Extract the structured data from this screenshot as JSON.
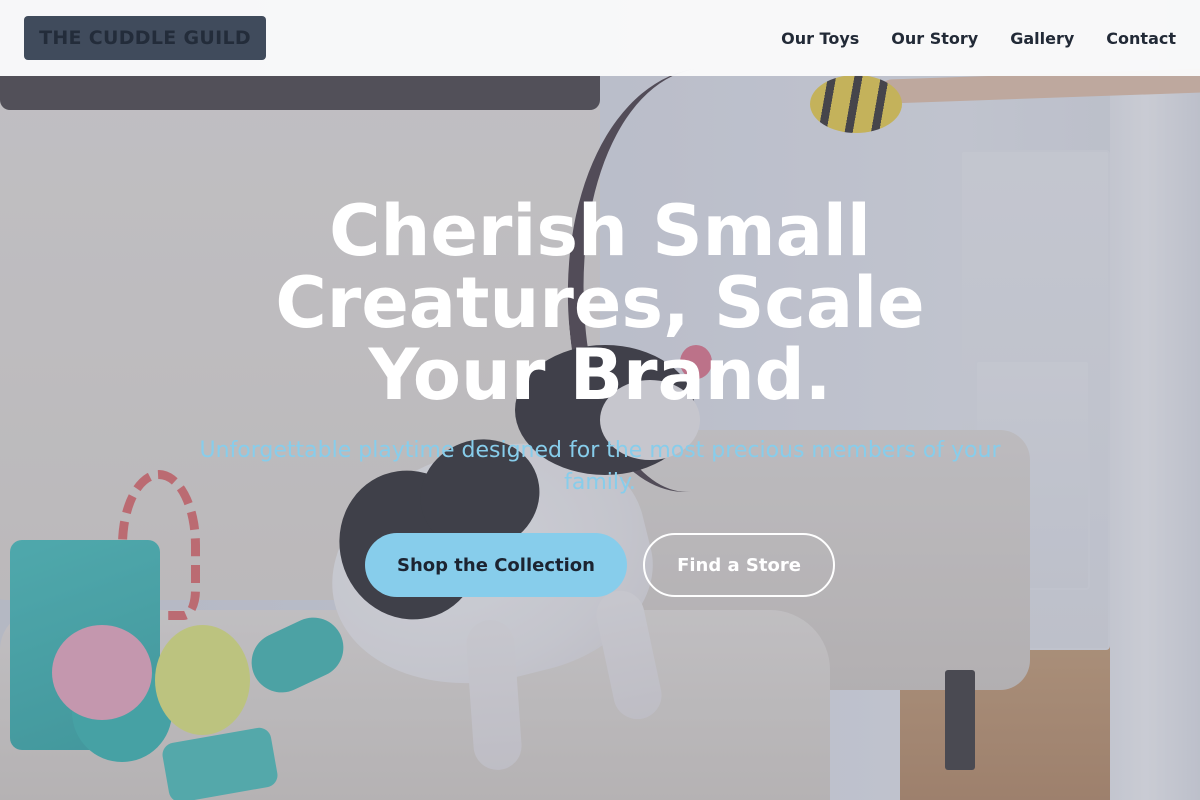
{
  "header": {
    "logo_text": "THE CUDDLE GUILD",
    "nav": [
      {
        "label": "Our Toys"
      },
      {
        "label": "Our Story"
      },
      {
        "label": "Gallery"
      },
      {
        "label": "Contact"
      }
    ]
  },
  "hero": {
    "headline": "Cherish Small Creatures, Scale Your Brand.",
    "subheadline": "Unforgettable playtime designed for the most precious members of your family.",
    "primary_cta": "Shop the Collection",
    "secondary_cta": "Find a Store"
  },
  "colors": {
    "accent": "#87cdeb",
    "logo_bg": "#404b5c",
    "header_bg": "#fafafb",
    "heading": "#ffffff"
  },
  "background_image": {
    "subject": "french-bulldog-on-sofa-with-toys"
  }
}
